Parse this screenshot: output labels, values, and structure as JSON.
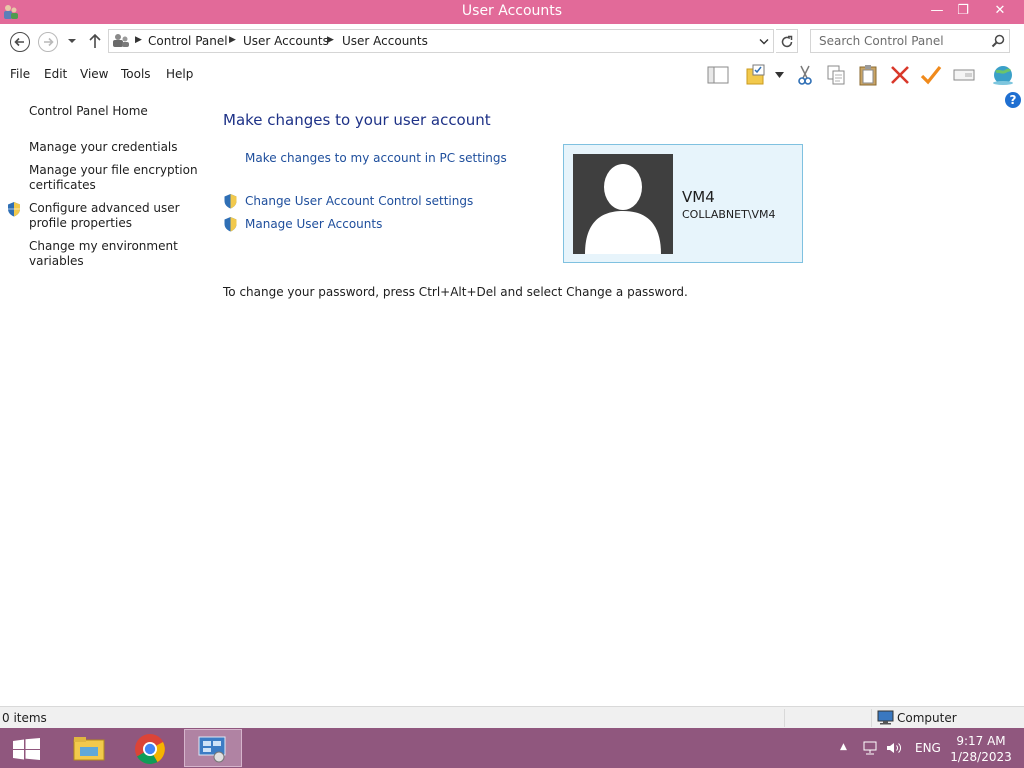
{
  "window": {
    "title": "User Accounts",
    "controls": {
      "minimize": "—",
      "maximize": "❐",
      "close": "✕"
    }
  },
  "navigation": {
    "breadcrumbs": [
      "Control Panel",
      "User Accounts",
      "User Accounts"
    ],
    "search_placeholder": "Search Control Panel"
  },
  "menu": {
    "items": [
      "File",
      "Edit",
      "View",
      "Tools",
      "Help"
    ]
  },
  "toolbar": {
    "icons": [
      "layout-pane-icon",
      "folder-properties-icon",
      "cut-icon",
      "copy-icon",
      "paste-icon",
      "delete-icon",
      "checkmark-icon",
      "rename-icon",
      "globe-icon"
    ]
  },
  "sidebar": {
    "items": [
      {
        "label": "Control Panel Home"
      },
      {
        "label": "Manage your credentials"
      },
      {
        "label": "Manage your file encryption certificates"
      },
      {
        "label": "Configure advanced user profile properties",
        "shield": true
      },
      {
        "label": "Change my environment variables"
      }
    ]
  },
  "main": {
    "heading": "Make changes to your user account",
    "links": [
      {
        "label": "Make changes to my account in PC settings"
      },
      {
        "label": "Change User Account Control settings",
        "shield": true
      },
      {
        "label": "Manage User Accounts",
        "shield": true
      }
    ],
    "password_note": "To change your password, press Ctrl+Alt+Del and select Change a password."
  },
  "user": {
    "name": "VM4",
    "domain": "COLLABNET\\VM4"
  },
  "status": {
    "items": "0 items",
    "location": "Computer"
  },
  "taskbar": {
    "lang": "ENG",
    "time": "9:17 AM",
    "date": "1/28/2023"
  },
  "colors": {
    "titlebar": "#e26a99",
    "taskbar": "#90577e",
    "link": "#1e4e9c",
    "heading": "#1e3287",
    "card_bg": "#e7f4fb",
    "card_border": "#7fc1e0"
  }
}
